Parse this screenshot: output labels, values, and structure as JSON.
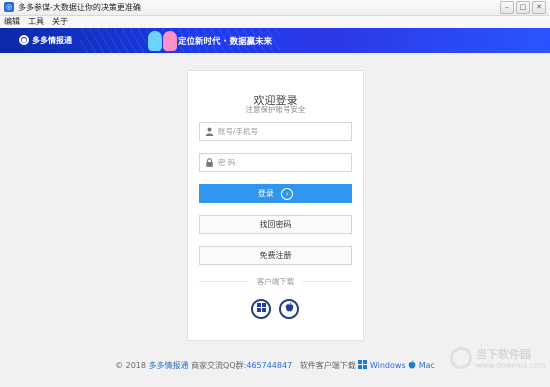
{
  "window": {
    "title": "多多参谋-大数据让你的决策更准确",
    "controls": [
      "–",
      "□",
      "✕"
    ]
  },
  "menu": [
    "编辑",
    "工具",
    "关于"
  ],
  "banner": {
    "brand": "多多情报通",
    "slogan": "定位新时代 · 数据赢未来"
  },
  "login": {
    "welcome": "欢迎登录",
    "subtitle": "注意保护账号安全",
    "account_placeholder": "账号/手机号",
    "password_placeholder": "密 码",
    "login_label": "登录",
    "recover_label": "找回密码",
    "register_label": "免费注册",
    "client_download_label": "客户端下载"
  },
  "icons": {
    "user": "user-icon",
    "lock": "lock-icon",
    "arrow": "arrow-right-circle-icon",
    "windows": "windows-icon",
    "apple": "apple-icon"
  },
  "footer": {
    "copyright": "© 2018",
    "brand": "多多情报通",
    "qq_label": "商家交流QQ群:",
    "qq_number": "465744847",
    "download_label": "软件客户端下载",
    "windows": "Windows",
    "mac": "Mac"
  },
  "watermark": {
    "line1": "当下软件园",
    "line2": "www.downxia.com"
  },
  "colors": {
    "primary_button": "#2e96ef",
    "banner": "#1d3cf0",
    "os_button": "#233e8c",
    "link": "#2a6bd9"
  }
}
